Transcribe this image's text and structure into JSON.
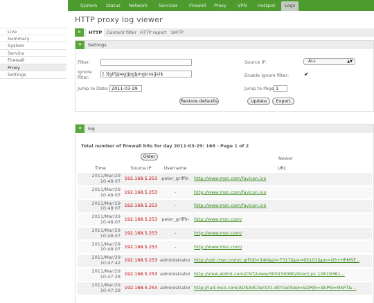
{
  "nav": {
    "items": [
      {
        "label": "System"
      },
      {
        "label": "Status"
      },
      {
        "label": "Network"
      },
      {
        "label": "Services"
      },
      {
        "label": "Firewall"
      },
      {
        "label": "Proxy"
      },
      {
        "label": "VPN"
      },
      {
        "label": "Hotspot"
      },
      {
        "label": "Logs"
      }
    ],
    "active": "Logs"
  },
  "page_title": "HTTP proxy log viewer",
  "sidebar": {
    "items": [
      {
        "label": "Live"
      },
      {
        "label": "Summary"
      },
      {
        "label": "System"
      },
      {
        "label": "Service"
      },
      {
        "label": "Firewall"
      },
      {
        "label": "Proxy"
      },
      {
        "label": "Settings"
      }
    ],
    "active": "Proxy"
  },
  "tabs": {
    "chevron": "»",
    "items": [
      {
        "label": "HTTP"
      },
      {
        "label": "Content filter"
      },
      {
        "label": "HTTP report"
      },
      {
        "label": "SMTP"
      }
    ],
    "active": "HTTP"
  },
  "settings": {
    "title": "Settings",
    "filter_label": "Filter:",
    "filter_value": "",
    "ignore_label_1": "Ignore",
    "ignore_label_2": "filter:",
    "ignore_value": "[.](gif|jpeg|jpg|png|css|js)$",
    "jump_date_label": "Jump to Date:",
    "jump_date_value": "2011-03-29",
    "source_ip_label": "Source IP:",
    "source_ip_value": "ALL",
    "enable_ignore_label": "Enable ignore filter:",
    "enable_ignore_checked": true,
    "check_glyph": "✔",
    "jump_page_label": "Jump to Page:",
    "jump_page_value": "1",
    "restore_label": "Restore defaults",
    "update_label": "Update",
    "export_label": "Export"
  },
  "log": {
    "title": "log",
    "summary": "Total number of firewall hits for day 2011-03-29: 168 - Page 1 of 2",
    "older_label": "Older",
    "newer_label": "Newer",
    "columns": {
      "time": "Time",
      "source_ip": "Source IP",
      "username": "Username",
      "url": "URL"
    },
    "rows": [
      {
        "date": "2011/Mar/29",
        "clock": "10:48:07",
        "ip": "192.168.5.253",
        "user": "peter_griffin",
        "url": "http://www.msn.com/favicon.ico"
      },
      {
        "date": "2011/Mar/29",
        "clock": "10:48:07",
        "ip": "192.168.5.253",
        "user": "-",
        "url": "http://www.msn.com/favicon.ico"
      },
      {
        "date": "2011/Mar/29",
        "clock": "10:48:07",
        "ip": "192.168.5.253",
        "user": "-",
        "url": "http://www.msn.com/favicon.ico"
      },
      {
        "date": "2011/Mar/29",
        "clock": "10:48:07",
        "ip": "192.168.5.253",
        "user": "peter_griffin",
        "url": "http://www.msn.com/"
      },
      {
        "date": "2011/Mar/29",
        "clock": "10:48:07",
        "ip": "192.168.5.253",
        "user": "-",
        "url": "http://www.msn.com/"
      },
      {
        "date": "2011/Mar/29",
        "clock": "10:48:07",
        "ip": "192.168.5.253",
        "user": "-",
        "url": "http://www.msn.com/"
      },
      {
        "date": "2011/Mar/29",
        "clock": "10:47:42",
        "ip": "192.168.5.253",
        "user": "administrator",
        "url": "http://udc.msn.com/c.gif?di=340&pi=7317&ps=95101&pn=US+HPMSF..."
      },
      {
        "date": "2011/Mar/29",
        "clock": "10:47:28",
        "ip": "192.168.5.253",
        "user": "administrator",
        "url": "http://view.atdmt.com/CNT/iview/300159080/direct;pc.10619361..."
      },
      {
        "date": "2011/Mar/29",
        "clock": "10:47:28",
        "ip": "192.168.5.253",
        "user": "administrator",
        "url": "http://rad.msn.com/ADSAdClient31.dll?GetSAd=&DPJS=4&PN=MSFT&..."
      }
    ]
  }
}
